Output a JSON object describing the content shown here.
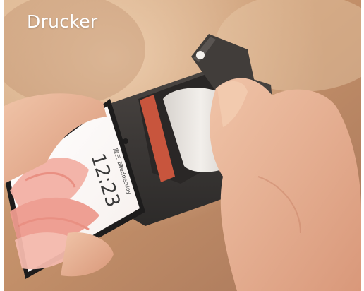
{
  "caption": "Drucker",
  "phone_lockscreen": {
    "time": "12:23",
    "date": "周三 12",
    "weekday": "Wednesday"
  },
  "colors": {
    "background": "#c59a73",
    "device_body": "#3b3836",
    "paper_roll": "#e9e5e0",
    "skin": "#e7b59a",
    "screen_flower": "#f0a79b"
  }
}
